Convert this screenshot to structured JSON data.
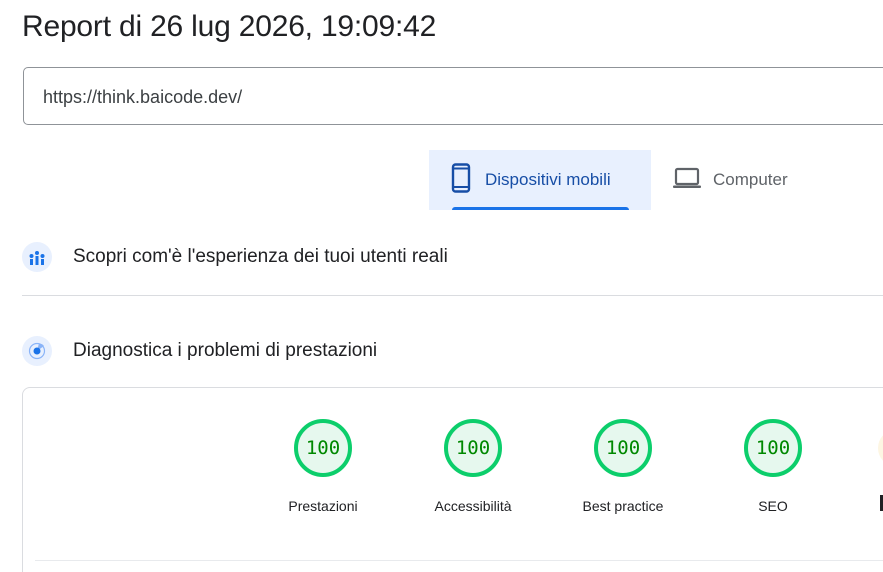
{
  "report": {
    "title": "Report di 26 lug 2026, 19:09:42",
    "url": "https://think.baicode.dev/"
  },
  "tabs": [
    {
      "label": "Dispositivi mobili",
      "icon": "smartphone-icon",
      "selected": true
    },
    {
      "label": "Computer",
      "icon": "laptop-icon",
      "selected": false
    }
  ],
  "sections": {
    "field_data": {
      "title": "Scopri com'è l'esperienza dei tuoi utenti reali",
      "icon": "users-chart-icon"
    },
    "diagnostics": {
      "title": "Diagnostica i problemi di prestazioni",
      "icon": "lighthouse-icon"
    }
  },
  "scores": [
    {
      "label": "Prestazioni",
      "value": "100"
    },
    {
      "label": "Accessibilità",
      "value": "100"
    },
    {
      "label": "Best practice",
      "value": "100"
    },
    {
      "label": "SEO",
      "value": "100"
    }
  ],
  "colors": {
    "pass_ring": "#0cce6b",
    "pass_text": "#008800",
    "accent": "#1a73e8",
    "tab_selected_bg": "#e8f0fe"
  }
}
